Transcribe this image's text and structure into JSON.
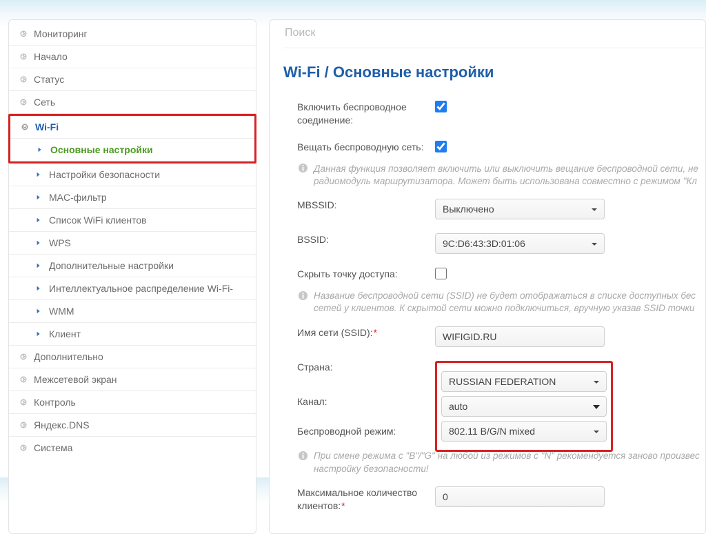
{
  "search": {
    "placeholder": "Поиск"
  },
  "page": {
    "title": "Wi-Fi /  Основные настройки"
  },
  "sidebar": {
    "items": [
      {
        "label": "Мониторинг"
      },
      {
        "label": "Начало"
      },
      {
        "label": "Статус"
      },
      {
        "label": "Сеть"
      },
      {
        "label": "Wi-Fi"
      },
      {
        "label": "Дополнительно"
      },
      {
        "label": "Межсетевой экран"
      },
      {
        "label": "Контроль"
      },
      {
        "label": "Яндекс.DNS"
      },
      {
        "label": "Система"
      }
    ],
    "wifi_sub": [
      {
        "label": "Основные настройки"
      },
      {
        "label": "Настройки безопасности"
      },
      {
        "label": "MAC-фильтр"
      },
      {
        "label": "Список WiFi клиентов"
      },
      {
        "label": "WPS"
      },
      {
        "label": "Дополнительные настройки"
      },
      {
        "label": "Интеллектуальное распределение Wi-Fi-"
      },
      {
        "label": "WMM"
      },
      {
        "label": "Клиент"
      }
    ]
  },
  "form": {
    "enable_wireless_label": "Включить беспроводное соединение:",
    "enable_wireless_value": true,
    "broadcast_label": "Вещать беспроводную сеть:",
    "broadcast_value": true,
    "broadcast_hint": "Данная функция позволяет включить или выключить вещание беспроводной сети, не радиомодуль маршрутизатора. Может быть использована совместно с режимом \"Кл",
    "mbssid_label": "MBSSID:",
    "mbssid_value": "Выключено",
    "bssid_label": "BSSID:",
    "bssid_value": "9C:D6:43:3D:01:06",
    "hide_ap_label": "Скрыть точку доступа:",
    "hide_ap_value": false,
    "hide_ap_hint": "Название беспроводной сети (SSID) не будет отображаться в списке доступных бес сетей у клиентов. К скрытой сети можно подключиться, вручную указав SSID точки ",
    "ssid_label": "Имя сети (SSID):",
    "ssid_value": "WIFIGID.RU",
    "country_label": "Страна:",
    "country_value": "RUSSIAN FEDERATION",
    "channel_label": "Канал:",
    "channel_value": "auto",
    "mode_label": "Беспроводной режим:",
    "mode_value": "802.11 B/G/N mixed",
    "mode_hint": "При смене режима с \"B\"/\"G\" на любой из режимов с \"N\" рекомендуется заново произвес настройку безопасности!",
    "max_clients_label": "Максимальное количество клиентов:",
    "max_clients_value": "0"
  }
}
